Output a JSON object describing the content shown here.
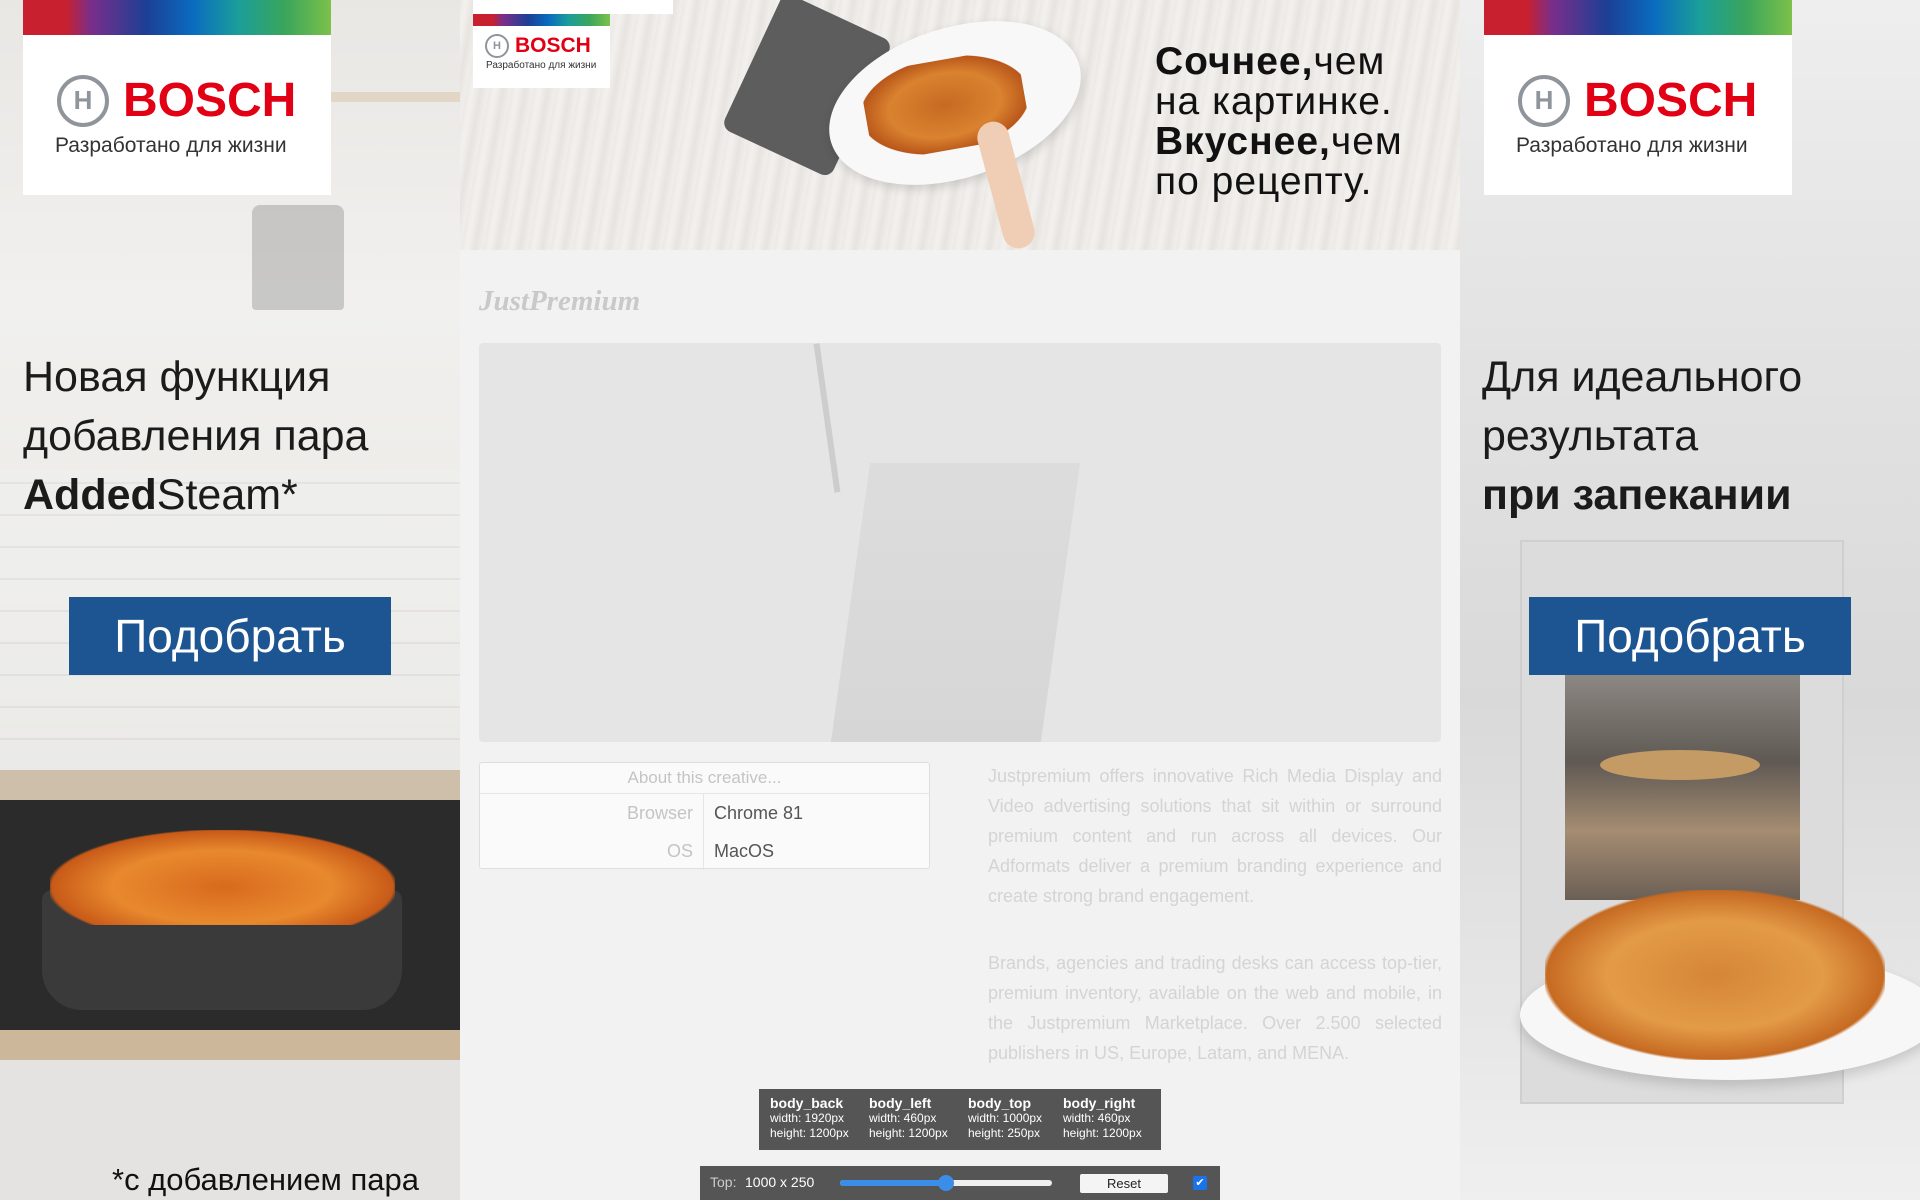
{
  "brand": {
    "name": "BOSCH",
    "tagline": "Разработано для жизни",
    "emblem": "H"
  },
  "left_skin": {
    "headline_line1": "Новая функция",
    "headline_line2": "добавления пара",
    "headline_bold": "Added",
    "headline_rest": "Steam*",
    "button_label": "Подобрать",
    "footnote": "*с добавлением пара"
  },
  "right_skin": {
    "headline_line1": "Для идеального",
    "headline_line2": "результата",
    "headline_bold": "при запекании",
    "button_label": "Подобрать"
  },
  "top_banner": {
    "line1_bold": "Сочнее,",
    "line1_rest": "чем",
    "line2": "на картинке.",
    "line3_bold": "Вкуснее,",
    "line3_rest": "чем",
    "line4": "по рецепту."
  },
  "main": {
    "logo": "JustPremium",
    "info": {
      "header": "About this creative...",
      "rows": [
        {
          "key": "Browser",
          "value": "Chrome 81"
        },
        {
          "key": "OS",
          "value": "MacOS"
        }
      ]
    },
    "paragraph1": "Justpremium offers innovative Rich Media Display and Video advertising solutions that sit within or surround premium content and run across all devices. Our Adformats deliver a premium branding experience and create strong brand engagement.",
    "paragraph2": "Brands, agencies and trading desks can access top-tier, premium inventory, available on the web and mobile, in the Justpremium Marketplace. Over 2.500 selected publishers in US, Europe, Latam, and MENA."
  },
  "dimensions": [
    {
      "name": "body_back",
      "width": "width: 1920px",
      "height": "height: 1200px"
    },
    {
      "name": "body_left",
      "width": "width: 460px",
      "height": "height: 1200px"
    },
    {
      "name": "body_top",
      "width": "width: 1000px",
      "height": "height: 250px"
    },
    {
      "name": "body_right",
      "width": "width: 460px",
      "height": "height: 1200px"
    }
  ],
  "controls": {
    "top_label": "Top:",
    "top_value": "1000 x 250",
    "slider_value": 0.5,
    "reset_label": "Reset",
    "checkbox_checked": true
  },
  "colors": {
    "bosch_red": "#e20015",
    "button_blue": "#1d5592"
  }
}
